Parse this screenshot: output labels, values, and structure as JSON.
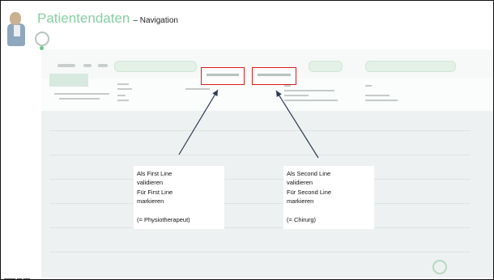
{
  "slide": {
    "title": "Patientendaten",
    "subtitle": "– Navigation"
  },
  "callouts": [
    {
      "line1": "Als First Line",
      "line2": "validieren",
      "line3": "Für First Line",
      "line4": "markieren",
      "role": "(= Physiotherapeut)"
    },
    {
      "line1": "Als Second Line",
      "line2": "validieren",
      "line3": "Für Second Line",
      "line4": "markieren",
      "role": "(= Chirurg)"
    }
  ],
  "colors": {
    "title": "#86cfa0",
    "highlight": "#e01b1b",
    "arrow": "#2b3a55"
  },
  "icons": {
    "corner": "doctor-portrait-icon",
    "bottom": "institution-logo-icon"
  }
}
